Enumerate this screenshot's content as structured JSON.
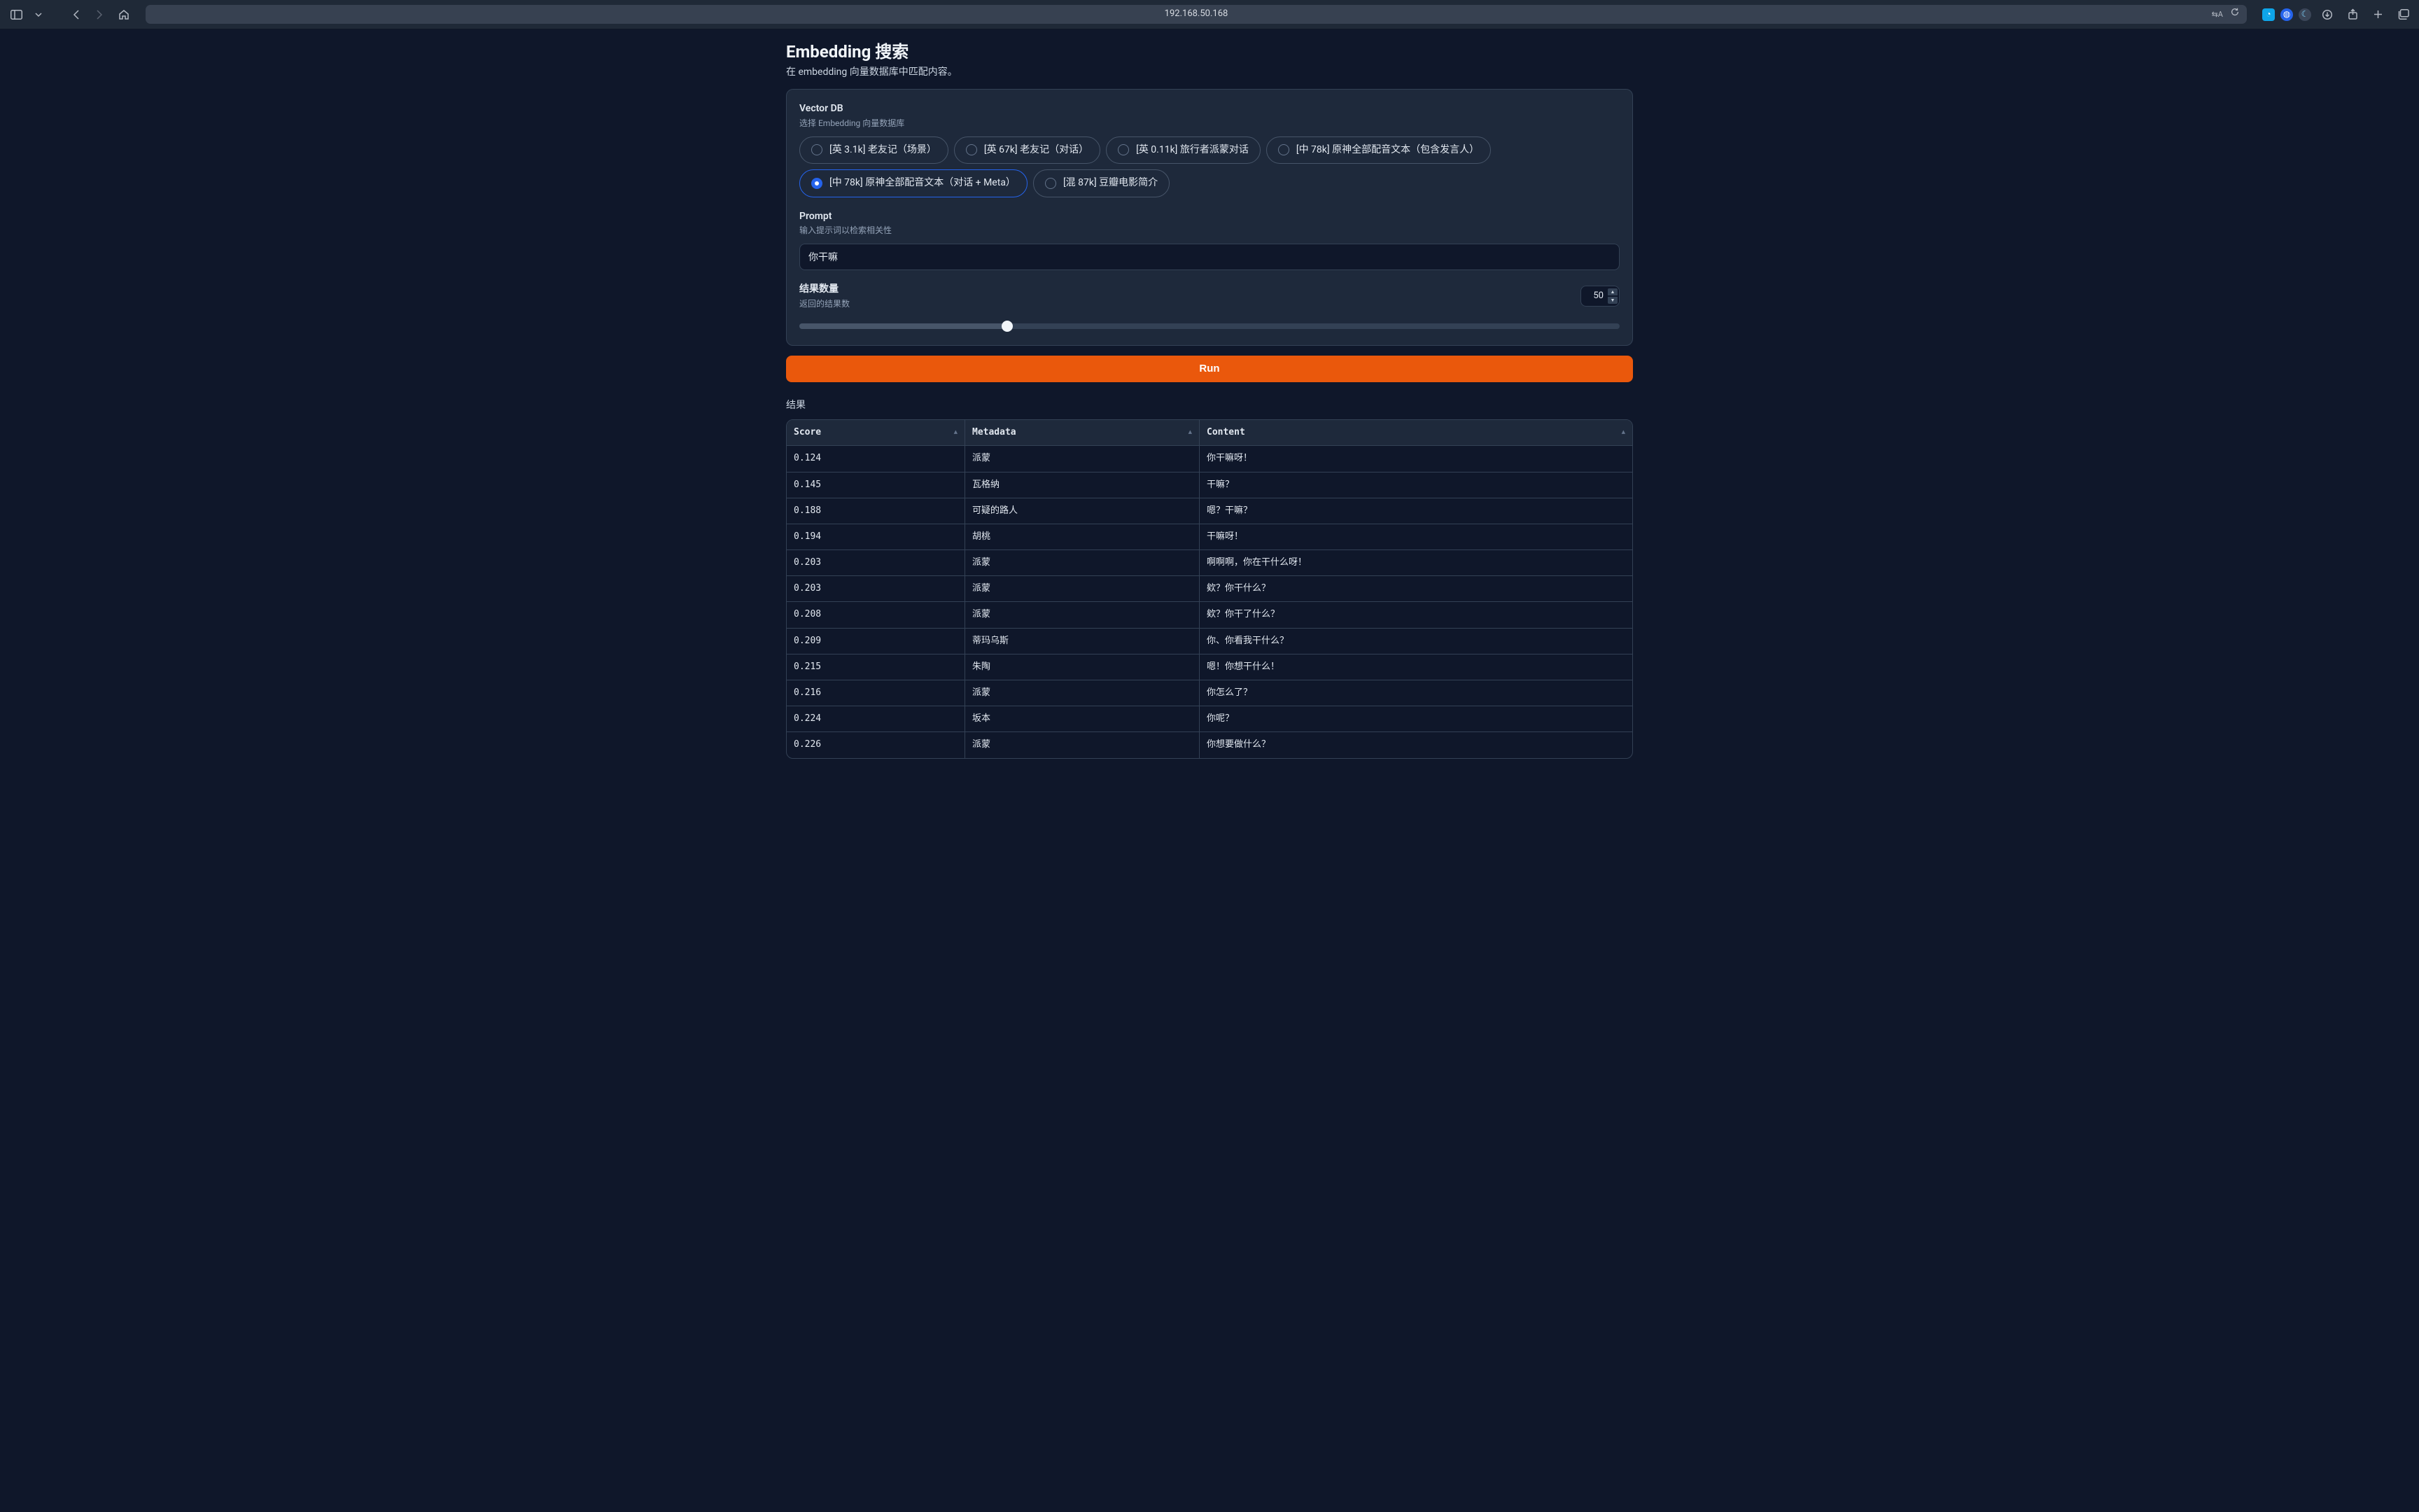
{
  "browser": {
    "url": "192.168.50.168"
  },
  "page": {
    "title": "Embedding 搜索",
    "subtitle": "在 embedding 向量数据库中匹配内容。"
  },
  "vectorDb": {
    "label": "Vector DB",
    "help": "选择 Embedding 向量数据库",
    "options": [
      "[英 3.1k] 老友记（场景）",
      "[英 67k] 老友记（对话）",
      "[英 0.11k] 旅行者派蒙对话",
      "[中 78k] 原神全部配音文本（包含发言人）",
      "[中 78k] 原神全部配音文本（对话 + Meta）",
      "[混 87k] 豆瓣电影简介"
    ],
    "selectedIndex": 4
  },
  "prompt": {
    "label": "Prompt",
    "help": "输入提示词以检索相关性",
    "value": "你干嘛"
  },
  "count": {
    "label": "结果数量",
    "help": "返回的结果数",
    "value": "50",
    "sliderPercent": 25.3
  },
  "run": {
    "label": "Run"
  },
  "results": {
    "label": "结果",
    "columns": [
      "Score",
      "Metadata",
      "Content"
    ],
    "rows": [
      {
        "score": "0.124",
        "metadata": "派蒙",
        "content": "你干嘛呀！"
      },
      {
        "score": "0.145",
        "metadata": "瓦格纳",
        "content": "干嘛？"
      },
      {
        "score": "0.188",
        "metadata": "可疑的路人",
        "content": "嗯？干嘛？"
      },
      {
        "score": "0.194",
        "metadata": "胡桃",
        "content": "干嘛呀！"
      },
      {
        "score": "0.203",
        "metadata": "派蒙",
        "content": "啊啊啊，你在干什么呀！"
      },
      {
        "score": "0.203",
        "metadata": "派蒙",
        "content": "欸？你干什么？"
      },
      {
        "score": "0.208",
        "metadata": "派蒙",
        "content": "欸？你干了什么？"
      },
      {
        "score": "0.209",
        "metadata": "蒂玛乌斯",
        "content": "你、你看我干什么？"
      },
      {
        "score": "0.215",
        "metadata": "朱陶",
        "content": "嗯！你想干什么！"
      },
      {
        "score": "0.216",
        "metadata": "派蒙",
        "content": "你怎么了？"
      },
      {
        "score": "0.224",
        "metadata": "坂本",
        "content": "你呢？"
      },
      {
        "score": "0.226",
        "metadata": "派蒙",
        "content": "你想要做什么？"
      }
    ]
  }
}
